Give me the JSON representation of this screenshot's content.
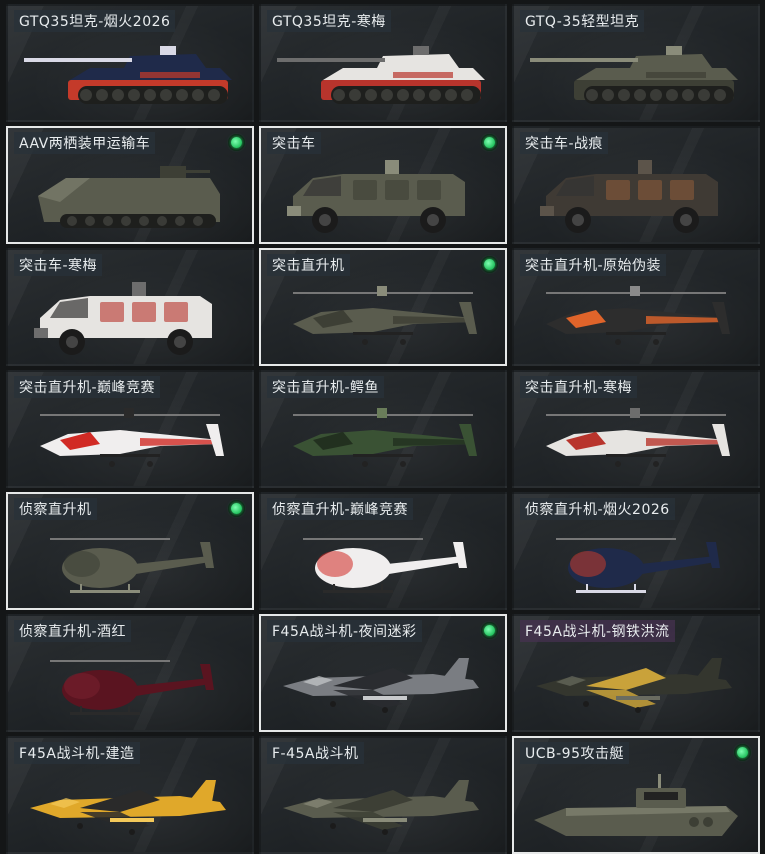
{
  "vehicles": [
    {
      "name": "GTQ35坦克-烟火2026",
      "kind": "tank",
      "skin": "firework",
      "owned": false,
      "selected": false
    },
    {
      "name": "GTQ35坦克-寒梅",
      "kind": "tank",
      "skin": "plum",
      "owned": false,
      "selected": false
    },
    {
      "name": "GTQ-35轻型坦克",
      "kind": "tank",
      "skin": "default",
      "owned": false,
      "selected": false
    },
    {
      "name": "AAV两栖装甲运输车",
      "kind": "aav",
      "skin": "default",
      "owned": true,
      "selected": true
    },
    {
      "name": "突击车",
      "kind": "truck",
      "skin": "default",
      "owned": true,
      "selected": true
    },
    {
      "name": "突击车-战痕",
      "kind": "truck",
      "skin": "scar",
      "owned": false,
      "selected": false
    },
    {
      "name": "突击车-寒梅",
      "kind": "truck",
      "skin": "plum",
      "owned": false,
      "selected": false
    },
    {
      "name": "突击直升机",
      "kind": "apache",
      "skin": "default",
      "owned": true,
      "selected": true
    },
    {
      "name": "突击直升机-原始伪装",
      "kind": "apache",
      "skin": "primal",
      "owned": false,
      "selected": false
    },
    {
      "name": "突击直升机-巅峰竞赛",
      "kind": "apache",
      "skin": "race",
      "owned": false,
      "selected": false
    },
    {
      "name": "突击直升机-鳄鱼",
      "kind": "apache",
      "skin": "croc",
      "owned": false,
      "selected": false
    },
    {
      "name": "突击直升机-寒梅",
      "kind": "apache",
      "skin": "plum",
      "owned": false,
      "selected": false
    },
    {
      "name": "侦察直升机",
      "kind": "scout",
      "skin": "default",
      "owned": true,
      "selected": true
    },
    {
      "name": "侦察直升机-巅峰竞赛",
      "kind": "scout",
      "skin": "race",
      "owned": false,
      "selected": false
    },
    {
      "name": "侦察直升机-烟火2026",
      "kind": "scout",
      "skin": "firework",
      "owned": false,
      "selected": false
    },
    {
      "name": "侦察直升机-酒红",
      "kind": "scout",
      "skin": "wine",
      "owned": false,
      "selected": false
    },
    {
      "name": "F45A战斗机-夜间迷彩",
      "kind": "jet",
      "skin": "nightcamo",
      "owned": true,
      "selected": true
    },
    {
      "name": "F45A战斗机-钢铁洪流",
      "kind": "jet",
      "skin": "steel",
      "owned": false,
      "selected": false,
      "label_style": "purple"
    },
    {
      "name": "F45A战斗机-建造",
      "kind": "jet",
      "skin": "build",
      "owned": false,
      "selected": false
    },
    {
      "name": "F-45A战斗机",
      "kind": "jet",
      "skin": "default",
      "owned": false,
      "selected": false
    },
    {
      "name": "UCB-95攻击艇",
      "kind": "boat",
      "skin": "default",
      "owned": true,
      "selected": true
    }
  ],
  "skin_colors": {
    "firework": {
      "body": "#1f2a4a",
      "accent": "#c43a2a",
      "detail": "#d9d9e6"
    },
    "plum": {
      "body": "#e6e4e1",
      "accent": "#b8342c",
      "detail": "#6d6d6d"
    },
    "default": {
      "body": "#5a5c4e",
      "accent": "#3d3f35",
      "detail": "#8a8c7a"
    },
    "scar": {
      "body": "#3f3a34",
      "accent": "#8a5a3a",
      "detail": "#5c544a"
    },
    "primal": {
      "body": "#2d2d2d",
      "accent": "#e0642a",
      "detail": "#8a8a8a"
    },
    "race": {
      "body": "#f0eeee",
      "accent": "#d12a24",
      "detail": "#2a2a2a"
    },
    "croc": {
      "body": "#3a5234",
      "accent": "#22301f",
      "detail": "#6a7d5a"
    },
    "wine": {
      "body": "#5a1420",
      "accent": "#7a2030",
      "detail": "#2a2a2a"
    },
    "nightcamo": {
      "body": "#7a7d82",
      "accent": "#2a2c30",
      "detail": "#c8cacc"
    },
    "steel": {
      "body": "#34362e",
      "accent": "#c9a23a",
      "detail": "#6a6c60"
    },
    "build": {
      "body": "#e0a82a",
      "accent": "#2a2a2a",
      "detail": "#f4c95a"
    }
  }
}
